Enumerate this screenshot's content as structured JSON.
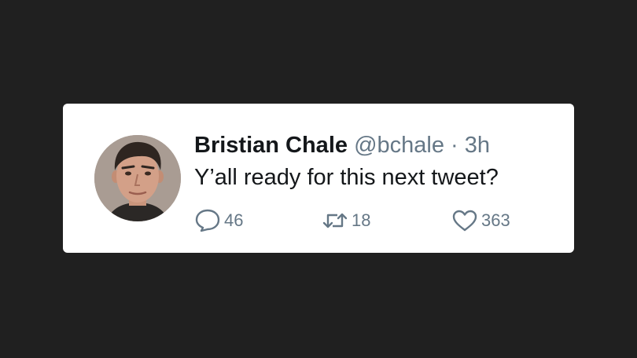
{
  "tweet": {
    "author_name": "Bristian Chale",
    "handle": "@bchale",
    "separator": "·",
    "time": "3h",
    "text": "Y’all ready for this next tweet?",
    "replies": "46",
    "retweets": "18",
    "likes": "363"
  },
  "icons": {
    "avatar": "profile-photo",
    "reply": "comment-bubble-icon",
    "retweet": "retweet-icon",
    "like": "heart-icon"
  },
  "colors": {
    "background": "#202020",
    "card": "#ffffff",
    "primary_text": "#14171a",
    "secondary_text": "#657786"
  }
}
